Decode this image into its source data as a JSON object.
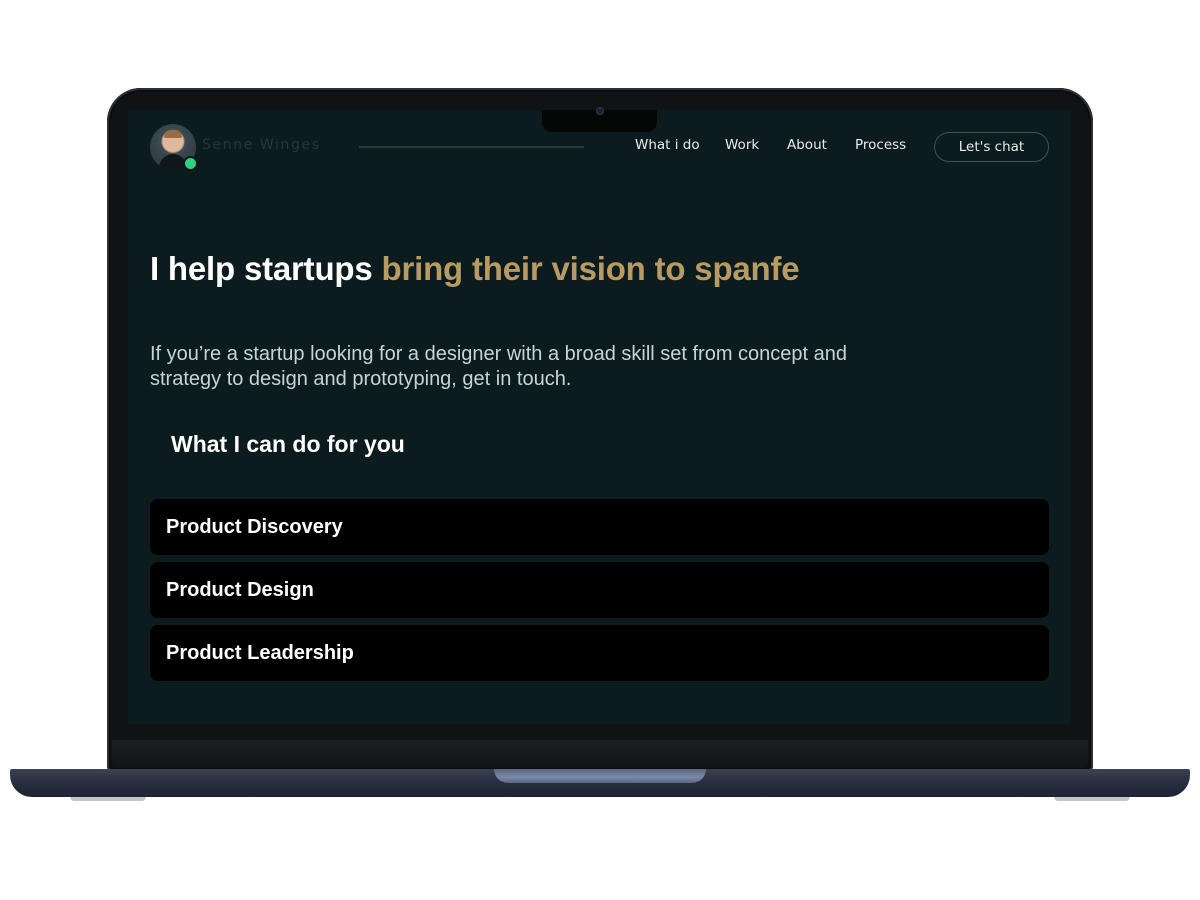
{
  "nav": {
    "brand_name": "Senne Winges",
    "links": [
      "What i do",
      "Work",
      "About",
      "Process"
    ],
    "cta_label": "Let's chat"
  },
  "hero": {
    "headline_start": "I help startups",
    "headline_accent": "bring their vision to spanfe"
  },
  "intro": {
    "text": "If you’re a startup looking for a designer with a broad skill set from concept and strategy to design and prototyping, get in touch."
  },
  "services": {
    "title": "What I can do for you",
    "items": [
      "Product Discovery",
      "Product Design",
      "Product Leadership"
    ]
  },
  "colors": {
    "background": "#0c1b1d",
    "accent": "#b89a63",
    "status_online": "#2fd17f",
    "card": "#000000"
  }
}
